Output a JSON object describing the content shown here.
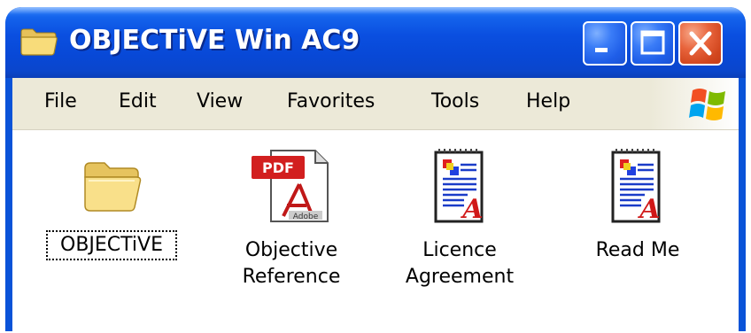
{
  "window": {
    "title": "OBJECTiVE Win AC9",
    "title_icon": "folder-icon",
    "controls": [
      "minimize-icon",
      "maximize-icon",
      "close-icon"
    ]
  },
  "menu": {
    "items": [
      "File",
      "Edit",
      "View",
      "Favorites",
      "Tools",
      "Help"
    ],
    "logo": "windows-logo-icon"
  },
  "files": [
    {
      "label_lines": [
        "OBJECTiVE"
      ],
      "icon": "folder-icon",
      "selected": true
    },
    {
      "label_lines": [
        "Objective",
        "Reference"
      ],
      "icon": "pdf-document-icon",
      "selected": false
    },
    {
      "label_lines": [
        "Licence",
        "Agreement"
      ],
      "icon": "text-document-icon",
      "selected": false
    },
    {
      "label_lines": [
        "Read Me"
      ],
      "icon": "text-document-icon",
      "selected": false
    }
  ],
  "colors": {
    "titlebar": "#0a4fe0",
    "menubar": "#ece9d8",
    "close_button": "#d2471f",
    "title_text": "#ffffff"
  }
}
